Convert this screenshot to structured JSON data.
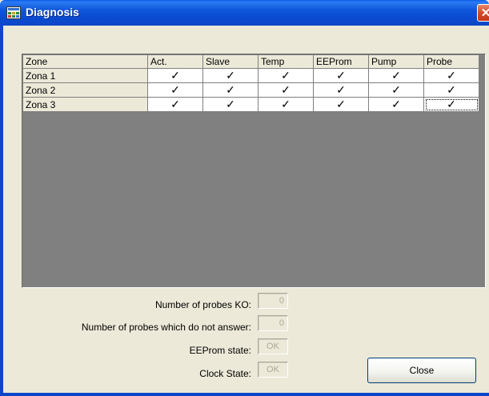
{
  "window": {
    "title": "Diagnosis",
    "close_glyph": "✕"
  },
  "grid": {
    "columns": [
      "Zone",
      "Act.",
      "Slave",
      "Temp",
      "EEProm",
      "Pump",
      "Probe"
    ],
    "rows": [
      {
        "zone": "Zona 1",
        "values": [
          "✓",
          "✓",
          "✓",
          "✓",
          "✓",
          "✓"
        ]
      },
      {
        "zone": "Zona 2",
        "values": [
          "✓",
          "✓",
          "✓",
          "✓",
          "✓",
          "✓"
        ]
      },
      {
        "zone": "Zona 3",
        "values": [
          "✓",
          "✓",
          "✓",
          "✓",
          "✓",
          "✓"
        ]
      }
    ],
    "empty_area_color": "#808080"
  },
  "status": {
    "probes_ko_label": "Number of probes KO:",
    "probes_ko_value": "0",
    "probes_no_answer_label": "Number of probes which do not answer:",
    "probes_no_answer_value": "0",
    "eeprom_label": "EEProm state:",
    "eeprom_value": "OK",
    "clock_label": "Clock State:",
    "clock_value": "OK"
  },
  "buttons": {
    "close_label": "Close"
  },
  "colors": {
    "titlebar": "#0a4ad0",
    "window_bg": "#ece9d8",
    "close_x": "#d24a2a"
  }
}
